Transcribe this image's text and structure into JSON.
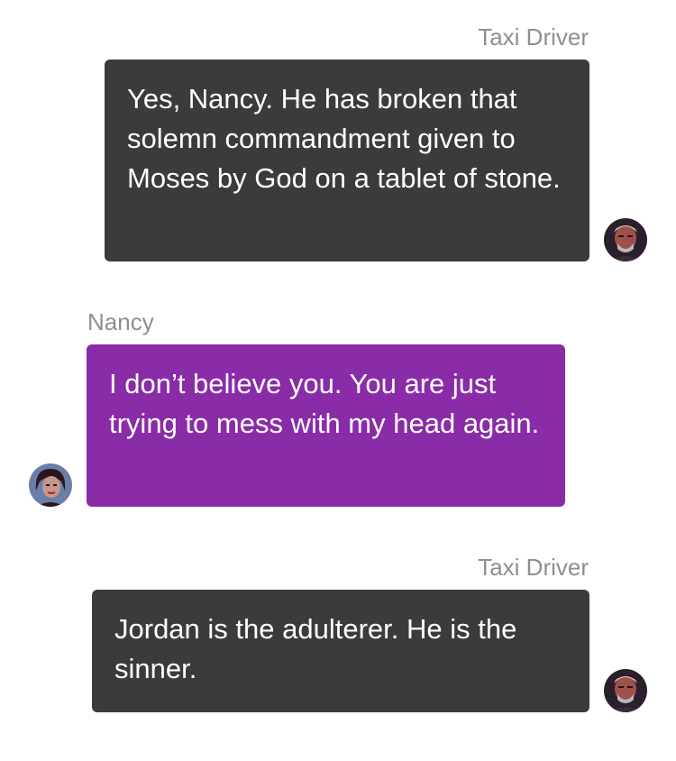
{
  "messages": [
    {
      "sender": "Taxi Driver",
      "text": "Yes, Nancy. He has broken that solemn commandment given to Moses by God on a tablet of stone.",
      "side": "right",
      "avatar_icon": "taxi-driver-avatar"
    },
    {
      "sender": "Nancy",
      "text": "I don’t believe you. You are just trying to mess with my head again.",
      "side": "left",
      "avatar_icon": "nancy-avatar"
    },
    {
      "sender": "Taxi Driver",
      "text": "Jordan is the adulterer. He is the sinner.",
      "side": "right",
      "avatar_icon": "taxi-driver-avatar"
    }
  ],
  "colors": {
    "sender_label": "#8e8e93",
    "incoming_bubble": "#3b3b3b",
    "outgoing_bubble": "#8a2ba8",
    "bubble_text": "#ffffff",
    "background": "#ffffff"
  }
}
